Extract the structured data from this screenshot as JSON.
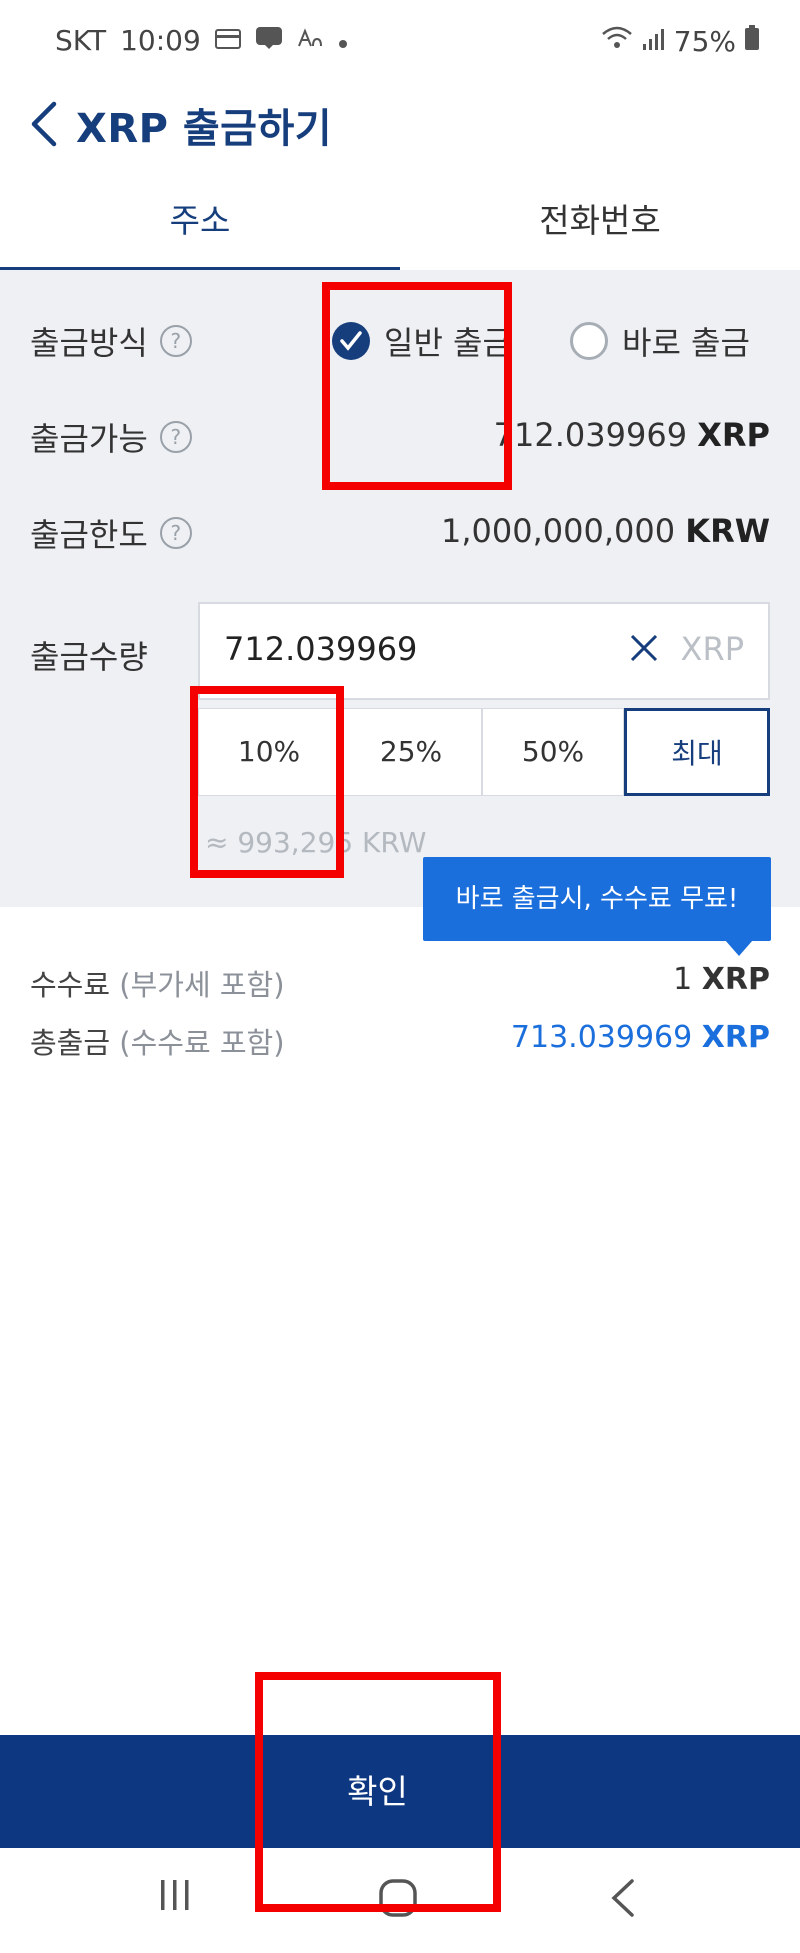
{
  "status_bar": {
    "carrier": "SKT",
    "time": "10:09",
    "battery": "75%"
  },
  "header": {
    "title": "XRP 출금하기"
  },
  "tabs": [
    {
      "label": "주소",
      "active": true
    },
    {
      "label": "전화번호",
      "active": false
    }
  ],
  "withdraw": {
    "method_label": "출금방식",
    "method_options": [
      {
        "label": "일반 출금",
        "selected": true
      },
      {
        "label": "바로 출금",
        "selected": false
      }
    ],
    "available_label": "출금가능",
    "available_value": "712.039969",
    "available_unit": "XRP",
    "limit_label": "출금한도",
    "limit_value": "1,000,000,000",
    "limit_unit": "KRW",
    "amount_label": "출금수량",
    "amount_value": "712.039969",
    "amount_unit": "XRP",
    "percent_buttons": [
      "10%",
      "25%",
      "50%",
      "최대"
    ],
    "krw_estimate": "≈ 993,295 KRW",
    "tooltip": "바로 출금시, 수수료 무료!"
  },
  "fees": {
    "fee_label": "수수료",
    "fee_sub": "(부가세 포함)",
    "fee_value": "1",
    "fee_unit": "XRP",
    "total_label": "총출금",
    "total_sub": "(수수료 포함)",
    "total_value": "713.039969",
    "total_unit": "XRP"
  },
  "confirm_label": "확인",
  "colors": {
    "brand": "#163e7d",
    "accent_blue": "#1b6fdc",
    "highlight_red": "#f50000"
  }
}
